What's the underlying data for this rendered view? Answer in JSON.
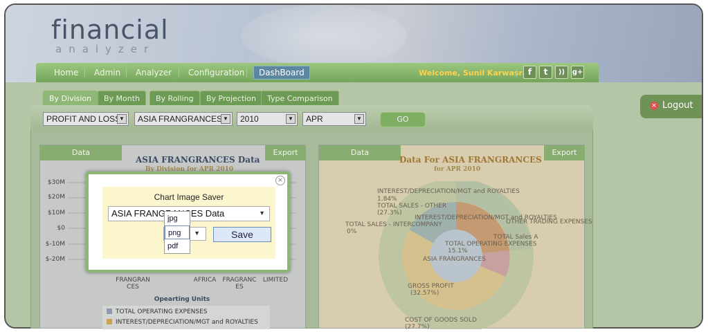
{
  "brand": {
    "line1": "financial",
    "line2": "analyzer"
  },
  "nav": {
    "items": [
      "Home",
      "Admin",
      "Analyzer",
      "Configuration",
      "DashBoard"
    ],
    "active": "DashBoard",
    "welcome": "Welcome, Sunil Karwasra"
  },
  "social": [
    "f",
    "t",
    "rss",
    "g+"
  ],
  "logout": "Logout",
  "tabs": [
    "By Division",
    "By Month",
    "By Rolling",
    "By Projection",
    "Type Comparison"
  ],
  "filters": {
    "report": "PROFIT AND LOSS",
    "division": "ASIA FRANGRANCES",
    "year": "2010",
    "month": "APR",
    "go": "GO"
  },
  "left_chart": {
    "data_tab": "Data",
    "export_tab": "Export",
    "title": "ASIA FRANGRANCES Data",
    "subtitle": "By Division for APR 2010",
    "y_ticks": [
      "$30M",
      "$20M",
      "$10M",
      "$0",
      "$-10M",
      "$-20M"
    ],
    "x_labels": [
      "FRANGRAN\nCES",
      "AFRICA",
      "FRAGRANC\nES",
      "LIMITED"
    ],
    "x_axis_title": "Opearting Units",
    "legend": [
      "TOTAL OPERATING EXPENSES",
      "INTEREST/DEPRECIATION/MGT and ROYALTIES"
    ]
  },
  "right_chart": {
    "data_tab": "Data",
    "export_tab": "Export",
    "title": "Data For ASIA FRANGRANCES",
    "subtitle": "for APR 2010",
    "labels": [
      "INTEREST/DEPRECIATION/MGT and ROYALTIES",
      "1.84%",
      "TOTAL SALES - OTHER",
      "(27.3%)",
      "TOTAL SALES - INTERCOMPANY",
      "0%",
      "INTEREST/DEPRECIATION/MGT and ROYALTIES",
      "OTHER TRADING EXPENSES",
      "TOTAL OPERATING EXPENSES",
      "15.1%",
      "TOTAL Sales A",
      "ASIA FRANGRANCES",
      "GROSS PROFIT",
      "(32.57%)",
      "COST OF GOODS SOLD",
      "(27.7%)"
    ]
  },
  "dialog": {
    "title": "Chart Image Saver",
    "chart_select": "ASIA FRANGRANCES Data",
    "format_selected": "png",
    "format_options": [
      "jpg",
      "png",
      "pdf"
    ],
    "save": "Save",
    "close": "×"
  },
  "colors": {
    "nav_green": "#74a55a",
    "accent_blue": "#5d86a0",
    "welcome": "#ffd24a"
  }
}
